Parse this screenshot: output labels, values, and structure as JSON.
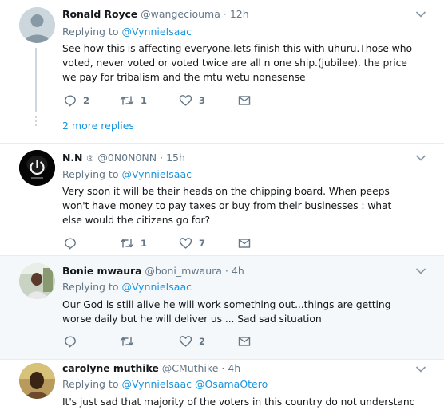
{
  "tweets": [
    {
      "name": "Ronald Royce",
      "handle": "@wangeciouma",
      "time": "12h",
      "replying_label": "Replying to",
      "replying_to": [
        "@VynnieIsaac"
      ],
      "text": "See how this is affecting everyone.lets finish this with uhuru.Those who voted, never voted or voted twice are all n one ship.(jubilee). the price we pay for tribalism and the mtu wetu nonesense",
      "replies": "2",
      "retweets": "1",
      "likes": "3",
      "more_replies": "2 more replies"
    },
    {
      "name": "N.N",
      "badge": "®",
      "handle": "@0N0N0NN",
      "time": "15h",
      "replying_label": "Replying to",
      "replying_to": [
        "@VynnieIsaac"
      ],
      "text": "Very soon it will be their heads on the chipping board. When peeps won't have money to pay taxes or buy from their businesses : what else would the citizens go for?",
      "replies": "",
      "retweets": "1",
      "likes": "7"
    },
    {
      "name": "Bonie mwaura",
      "handle": "@boni_mwaura",
      "time": "4h",
      "replying_label": "Replying to",
      "replying_to": [
        "@VynnieIsaac"
      ],
      "text": "Our God is still alive he will work something out...things are getting worse daily but he will deliver us ... Sad sad situation",
      "replies": "",
      "retweets": "",
      "likes": "2"
    },
    {
      "name": "carolyne muthike",
      "handle": "@CMuthike",
      "time": "4h",
      "replying_label": "Replying to",
      "replying_to": [
        "@VynnieIsaac",
        "@OsamaOtero"
      ],
      "text": "It's just sad that majority of the voters in this country do not understand the"
    }
  ],
  "separator": "·",
  "colors": {
    "link": "#1b95e0",
    "muted": "#657786",
    "border": "#e6ecf0",
    "highlight_bg": "#f5f8fa"
  },
  "icons": [
    "reply-icon",
    "retweet-icon",
    "like-icon",
    "direct-message-icon",
    "chevron-down-icon"
  ]
}
